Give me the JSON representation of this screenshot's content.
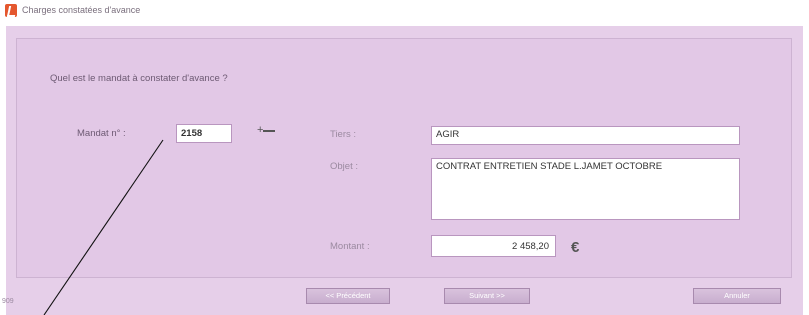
{
  "window": {
    "title": "Charges constatées d'avance"
  },
  "form": {
    "question": "Quel est le mandat à constater d'avance ?",
    "mandat_label": "Mandat n° :",
    "mandat_value": "2158",
    "tiers_label": "Tiers :",
    "tiers_value": "AGIR",
    "objet_label": "Objet :",
    "objet_value": "CONTRAT ENTRETIEN STADE L.JAMET OCTOBRE",
    "montant_label": "Montant :",
    "montant_value": "2 458,20",
    "currency_symbol": "€"
  },
  "buttons": {
    "prev": "<< Précédent",
    "next": "Suivant >>",
    "cancel": "Annuler"
  },
  "footer": {
    "code": "909"
  },
  "icons": {
    "app": "app-logo-icon",
    "search": "search-plus-icon"
  },
  "colors": {
    "background": "#e6cfe9",
    "panel": "#e2c8e6",
    "text": "#6d5a73",
    "button": "#c8aece",
    "accent": "#e4572e"
  }
}
